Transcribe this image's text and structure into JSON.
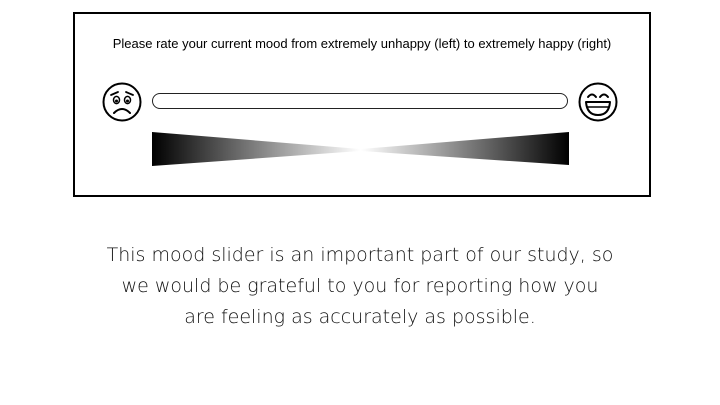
{
  "panel": {
    "prompt": "Please rate your current mood from extremely unhappy (left) to extremely happy (right)",
    "left_icon": "sad-face-icon",
    "right_icon": "happy-face-icon",
    "slider_value": null
  },
  "note": {
    "lines": [
      "This mood slider is an important part of our study, so",
      "we would be grateful to you for reporting how you",
      "are feeling as accurately as possible."
    ]
  },
  "colors": {
    "border": "#000000",
    "gradient_dark": "#000000",
    "gradient_light": "#ffffff"
  }
}
